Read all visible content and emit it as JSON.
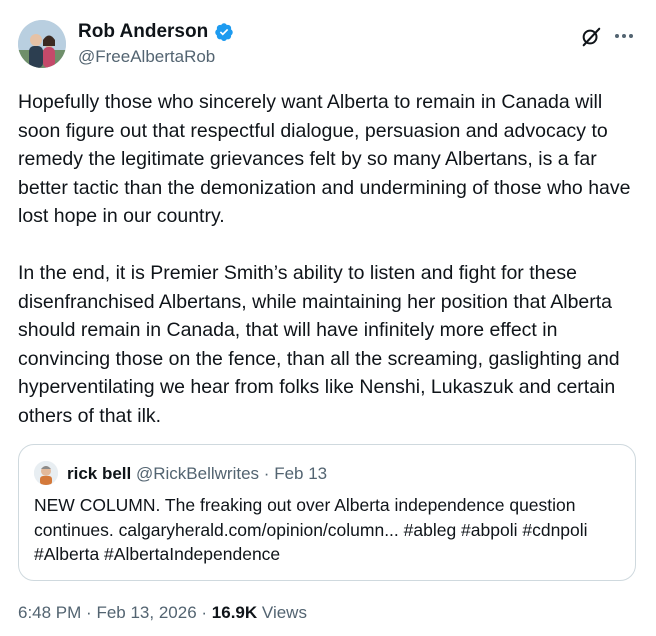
{
  "author": {
    "name": "Rob Anderson",
    "handle": "@FreeAlbertaRob",
    "avatar_alt": "profile photo"
  },
  "icons": {
    "verified": "verified-badge-icon",
    "grok": "grok-icon",
    "more": "more-options-icon"
  },
  "colors": {
    "verified": "#1d9bf0",
    "text": "#0f1419",
    "secondary": "#536471",
    "border": "#cfd9de"
  },
  "tweet": {
    "paragraph_1": "Hopefully those who sincerely want Alberta to remain in Canada will soon figure out that respectful dialogue, persuasion and advocacy to remedy the legitimate grievances felt by so many Albertans, is a far better tactic than the demonization and undermining of those who have lost hope in our country.",
    "paragraph_2": "In the end, it is Premier Smith’s ability to listen and fight for these disenfranchised Albertans, while maintaining her position that Alberta should remain in Canada, that will have infinitely more effect in convincing those on the fence, than all the screaming, gaslighting and hyperventilating we hear from folks like Nenshi, Lukaszuk and certain others of that ilk."
  },
  "quote": {
    "name": "rick bell",
    "handle": "@RickBellwrites",
    "separator": "·",
    "date": "Feb 13",
    "text": "NEW COLUMN. The freaking out over Alberta independence question continues. calgaryherald.com/opinion/column... #ableg #abpoli #cdnpoli #Alberta #AlbertaIndependence"
  },
  "footer": {
    "time": "6:48 PM",
    "separator": "·",
    "date": "Feb 13, 2026",
    "views_count": "16.9K",
    "views_label": "Views"
  }
}
